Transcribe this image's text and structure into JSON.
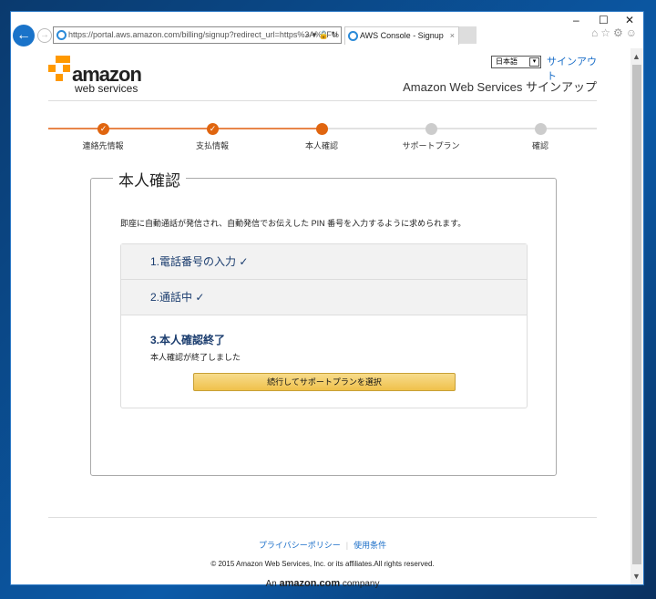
{
  "browser": {
    "url": "https://portal.aws.amazon.com/billing/signup?redirect_url=https%3A%2F%",
    "tab_title": "AWS Console - Signup",
    "minimize": "–",
    "maximize": "☐",
    "close": "✕"
  },
  "header": {
    "logo_amazon": "amazon",
    "logo_ws": "web services",
    "language": "日本語",
    "signout": "サインアウト",
    "title": "Amazon Web Services サインアップ"
  },
  "steps": [
    {
      "label": "連絡先情報",
      "state": "done"
    },
    {
      "label": "支払情報",
      "state": "done"
    },
    {
      "label": "本人確認",
      "state": "current"
    },
    {
      "label": "サポートプラン",
      "state": "todo"
    },
    {
      "label": "確認",
      "state": "todo"
    }
  ],
  "colors": {
    "accent": "#e0650f",
    "inactive": "#cccccc",
    "link": "#1a6ec8"
  },
  "main": {
    "legend": "本人確認",
    "intro": "即座に自動通話が発信され、自動発信でお伝えした PIN 番号を入力するように求められます。",
    "step1": "1.電話番号の入力 ✓",
    "step2": "2.通話中 ✓",
    "step3_title": "3.本人確認終了",
    "step3_text": "本人確認が終了しました",
    "button": "続行してサポートプランを選択"
  },
  "footer": {
    "privacy": "プライバシーポリシー",
    "terms": "使用条件",
    "copyright": "© 2015 Amazon Web Services, Inc. or its affiliates.All rights reserved.",
    "company_pre": "An",
    "company_brand": "amazon.com",
    "company_post": "company"
  }
}
